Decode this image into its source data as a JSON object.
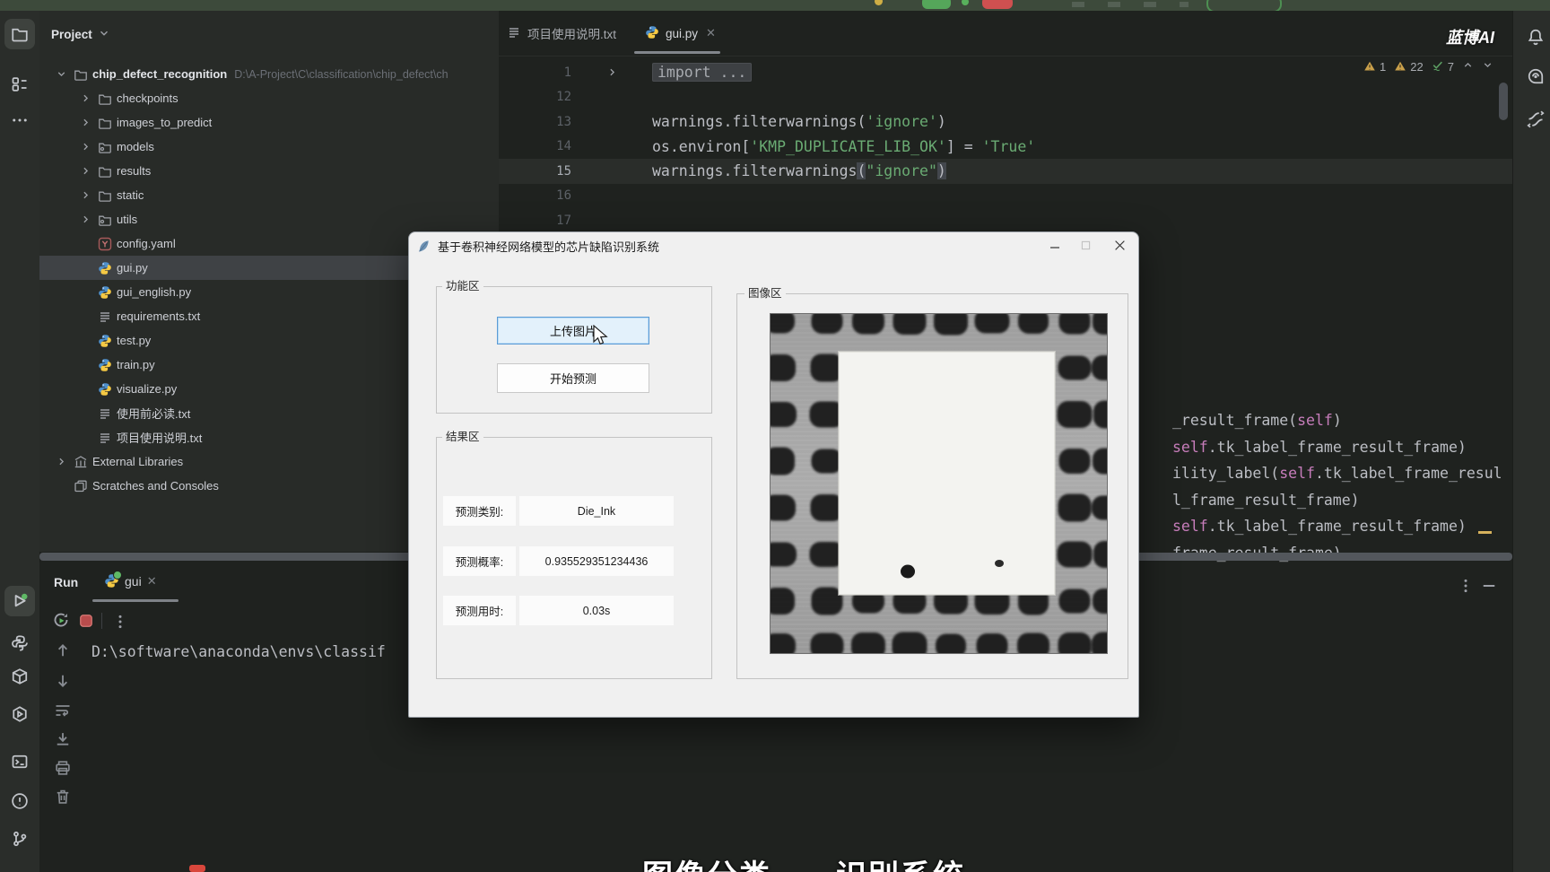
{
  "window": {
    "watermark": "蓝博AI"
  },
  "left_stripe": {
    "top_items": [
      {
        "icon": "project-folder-icon",
        "active": true
      },
      {
        "icon": "structure-icon",
        "active": false
      },
      {
        "icon": "more-icon",
        "active": false
      }
    ],
    "bottom_items": [
      {
        "icon": "run-icon",
        "active": true
      },
      {
        "icon": "python-console-icon",
        "active": false
      },
      {
        "icon": "python-packages-icon",
        "active": false
      },
      {
        "icon": "services-icon",
        "active": false
      },
      {
        "icon": "terminal-icon",
        "active": false
      },
      {
        "icon": "problems-icon",
        "active": false
      },
      {
        "icon": "version-control-icon",
        "active": false
      }
    ]
  },
  "right_stripe": {
    "items": [
      {
        "icon": "notifications-bell-icon"
      },
      {
        "icon": "ai-assistant-icon"
      },
      {
        "icon": "code-with-me-icon"
      }
    ]
  },
  "project_panel": {
    "header": "Project",
    "tree": [
      {
        "label": "chip_defect_recognition",
        "hint": "D:\\A-Project\\C\\classification\\chip_defect\\ch",
        "icon": "folder",
        "level": 0,
        "chevron": "down",
        "bold": true
      },
      {
        "label": "checkpoints",
        "icon": "folder",
        "level": 1,
        "chevron": "right"
      },
      {
        "label": "images_to_predict",
        "icon": "folder",
        "level": 1,
        "chevron": "right"
      },
      {
        "label": "models",
        "icon": "package",
        "level": 1,
        "chevron": "right"
      },
      {
        "label": "results",
        "icon": "folder",
        "level": 1,
        "chevron": "right"
      },
      {
        "label": "static",
        "icon": "folder",
        "level": 1,
        "chevron": "right"
      },
      {
        "label": "utils",
        "icon": "package",
        "level": 1,
        "chevron": "right"
      },
      {
        "label": "config.yaml",
        "icon": "yaml",
        "level": 1
      },
      {
        "label": "gui.py",
        "icon": "python",
        "level": 1,
        "selected": true
      },
      {
        "label": "gui_english.py",
        "icon": "python",
        "level": 1
      },
      {
        "label": "requirements.txt",
        "icon": "text",
        "level": 1
      },
      {
        "label": "test.py",
        "icon": "python",
        "level": 1
      },
      {
        "label": "train.py",
        "icon": "python",
        "level": 1
      },
      {
        "label": "visualize.py",
        "icon": "python",
        "level": 1
      },
      {
        "label": "使用前必读.txt",
        "icon": "text",
        "level": 1
      },
      {
        "label": "项目使用说明.txt",
        "icon": "text",
        "level": 1
      },
      {
        "label": "External Libraries",
        "icon": "library",
        "level": 0,
        "chevron": "right"
      },
      {
        "label": "Scratches and Consoles",
        "icon": "scratch",
        "level": 0
      }
    ]
  },
  "editor": {
    "tabs": [
      {
        "label": "项目使用说明.txt",
        "icon": "text",
        "active": false
      },
      {
        "label": "gui.py",
        "icon": "python",
        "active": true
      }
    ],
    "inspections": {
      "warning1": "1",
      "warning2": "22",
      "ok": "7"
    },
    "lines": [
      {
        "num": "1",
        "fold": true,
        "tokens": [
          {
            "t": "import ...",
            "c": "folded"
          }
        ]
      },
      {
        "num": "12",
        "tokens": []
      },
      {
        "num": "13",
        "tokens": [
          {
            "t": "warnings.filterwarnings(",
            "c": "fg"
          },
          {
            "t": "'ignore'",
            "c": "str"
          },
          {
            "t": ")",
            "c": "fg"
          }
        ]
      },
      {
        "num": "14",
        "tokens": [
          {
            "t": "os.environ[",
            "c": "fg"
          },
          {
            "t": "'KMP_DUPLICATE_LIB_OK'",
            "c": "str"
          },
          {
            "t": "] = ",
            "c": "fg"
          },
          {
            "t": "'True'",
            "c": "str"
          }
        ]
      },
      {
        "num": "15",
        "current": true,
        "tokens": [
          {
            "t": "warnings.filterwarnings",
            "c": "fg"
          },
          {
            "t": "(",
            "c": "brace"
          },
          {
            "t": "\"ignore\"",
            "c": "str"
          },
          {
            "t": ")",
            "c": "brace"
          }
        ]
      },
      {
        "num": "16",
        "tokens": []
      },
      {
        "num": "17",
        "tokens": []
      }
    ],
    "right_fragment": [
      [
        {
          "t": "_result_frame(",
          "c": "fg"
        },
        {
          "t": "self",
          "c": "kw"
        },
        {
          "t": ")",
          "c": "fg"
        }
      ],
      [
        {
          "t": "self",
          "c": "kw"
        },
        {
          "t": ".tk_label_frame_result_frame)",
          "c": "fg"
        }
      ],
      [
        {
          "t": "ility_label(",
          "c": "fg"
        },
        {
          "t": "self",
          "c": "kw"
        },
        {
          "t": ".tk_label_frame_resul",
          "c": "fg"
        }
      ],
      [
        {
          "t": "l_frame_result_frame)",
          "c": "fg"
        }
      ],
      [
        {
          "t": "self",
          "c": "kw"
        },
        {
          "t": ".tk_label_frame_result_frame)",
          "c": "fg"
        }
      ],
      [
        {
          "t": "frame_result_frame)",
          "c": "fg"
        }
      ]
    ]
  },
  "run_panel": {
    "title": "Run",
    "tab_label": "gui",
    "console_text": "D:\\software\\anaconda\\envs\\classif",
    "toolbar_icons": [
      "rerun-icon",
      "stop-icon",
      "kebab-icon"
    ],
    "gutter_icons": [
      "up-arrow-icon",
      "down-arrow-icon",
      "soft-wrap-icon",
      "scroll-end-icon",
      "print-icon",
      "clear-icon"
    ],
    "corner_icons": [
      "kebab-icon",
      "hide-icon"
    ]
  },
  "dialog": {
    "title": "基于卷积神经网络模型的芯片缺陷识别系统",
    "controls": {
      "minimize": "–",
      "maximize": "▢",
      "close": "✕"
    },
    "function_area": {
      "label": "功能区",
      "upload_button": "上传图片",
      "predict_button": "开始预测"
    },
    "result_area": {
      "label": "结果区",
      "rows": [
        {
          "label": "预测类别:",
          "value": "Die_Ink"
        },
        {
          "label": "预测概率:",
          "value": "0.935529351234436"
        },
        {
          "label": "预测用时:",
          "value": "0.03s"
        }
      ]
    },
    "image_area": {
      "label": "图像区"
    }
  },
  "subtitle_overlay": "图像分类——识别系统",
  "colors": {
    "ide_bg": "#1f221f",
    "panel_bg": "#282b28",
    "dialog_bg": "#f0f0f0",
    "upload_hover_bg": "#e3f1fb",
    "upload_hover_border": "#5b9bd5",
    "string_green": "#6aab73",
    "keyword_purple": "#c77dbb",
    "warning_yellow": "#c9a04a",
    "ok_green": "#5c9f63",
    "stop_red": "#b84c4c"
  }
}
